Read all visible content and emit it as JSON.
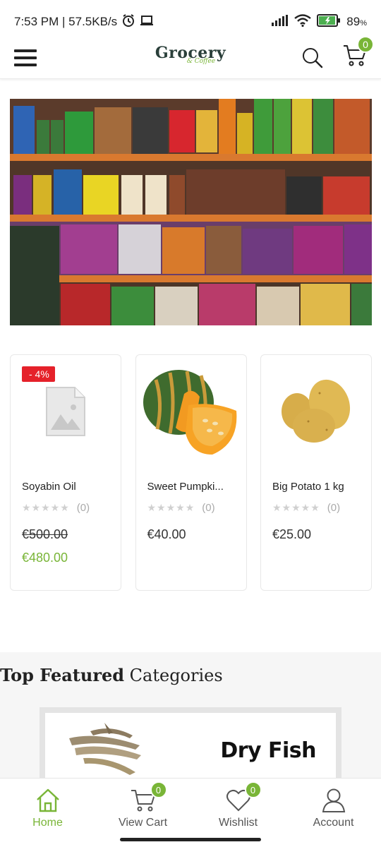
{
  "status_bar": {
    "time": "7:53 PM | 57.5KB/s",
    "battery": "89",
    "battery_unit": "%"
  },
  "header": {
    "logo_main": "Grocery",
    "logo_sub": "& Coffee",
    "cart_count": "0"
  },
  "products": [
    {
      "name": "Soyabin Oil",
      "sale_badge": "- 4%",
      "reviews": "(0)",
      "price_old": "€500.00",
      "price_sale": "€480.00",
      "image": "placeholder-image-icon"
    },
    {
      "name": "Sweet Pumpki...",
      "reviews": "(0)",
      "price": "€40.00",
      "image": "pumpkin-image"
    },
    {
      "name": "Big Potato 1 kg",
      "reviews": "(0)",
      "price": "€25.00",
      "image": "potato-image"
    }
  ],
  "categories": {
    "title_bold": "Top Featured",
    "title_light": "Categories",
    "items": [
      {
        "label": "Dry Fish"
      }
    ]
  },
  "bottom_nav": {
    "items": [
      {
        "label": "Home",
        "active": true
      },
      {
        "label": "View Cart",
        "badge": "0"
      },
      {
        "label": "Wishlist",
        "badge": "0"
      },
      {
        "label": "Account"
      }
    ]
  },
  "colors": {
    "accent": "#79b537",
    "sale": "#e5212a",
    "text": "#222222"
  }
}
